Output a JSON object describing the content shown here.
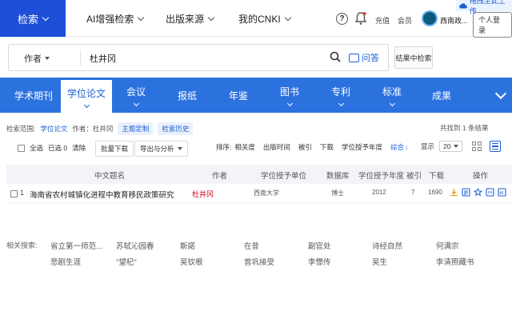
{
  "header": {
    "search_tab": "检索",
    "nav": [
      "AI增强检索",
      "出版来源",
      "我的CNKI"
    ],
    "recharge": "充值",
    "member": "会员",
    "org_name": "西南政...",
    "personal_login": "个人登录",
    "baidu_drag": "拖拽至此上传"
  },
  "search": {
    "field": "作者",
    "query": "杜井冈",
    "ask_label": "问答",
    "in_result_label": "结果中检索"
  },
  "categories": [
    {
      "label": "学术期刊",
      "chevron": false,
      "active": false
    },
    {
      "label": "学位论文",
      "chevron": true,
      "active": true
    },
    {
      "label": "会议",
      "chevron": true,
      "active": false
    },
    {
      "label": "报纸",
      "chevron": false,
      "active": false
    },
    {
      "label": "年鉴",
      "chevron": false,
      "active": false
    },
    {
      "label": "图书",
      "chevron": true,
      "active": false
    },
    {
      "label": "专利",
      "chevron": true,
      "active": false
    },
    {
      "label": "标准",
      "chevron": true,
      "active": false
    },
    {
      "label": "成果",
      "chevron": false,
      "active": false
    }
  ],
  "scope": {
    "label": "检索范围:",
    "value": "学位论文",
    "author_label": "作者：杜井冈",
    "subscribe": "主题定制",
    "history": "检索历史",
    "found_text": "共找到  1  条结果"
  },
  "toolbar": {
    "select_all": "全选",
    "selected": "已选  0",
    "clear": "清除",
    "batch_download": "批量下载",
    "export": "导出与分析",
    "sort_label": "排序:",
    "sort_options": [
      "相关度",
      "出版时间",
      "被引",
      "下载",
      "学位授予年度",
      "综合"
    ],
    "display_label": "显示",
    "page_size": "20"
  },
  "table": {
    "headers": [
      "中文题名",
      "作者",
      "学位授予单位",
      "数据库",
      "学位授予年度",
      "被引",
      "下载",
      "操作"
    ],
    "rows": [
      {
        "index": "1",
        "title": "海南省农村城镇化进程中教育移民政策研究",
        "author": "杜井冈",
        "unit": "西南大学",
        "db": "博士",
        "year": "2012",
        "cited": "7",
        "downloads": "1690"
      }
    ]
  },
  "related": {
    "label": "相关搜索:",
    "row1": [
      "省立第一师范...",
      "苏轼沁园春",
      "斯諾",
      "在昔",
      "副官处",
      "诗经自然",
      "何满宗"
    ],
    "row2": [
      "悲剧生涯",
      "\"望杞\"",
      "吴钦根",
      "曾巩接受",
      "李憬传",
      "吴生",
      "李清照藏书"
    ]
  },
  "colors": {
    "brand": "#1d4fd8",
    "catbar": "#2c72df",
    "accent_red": "#d0021b"
  }
}
